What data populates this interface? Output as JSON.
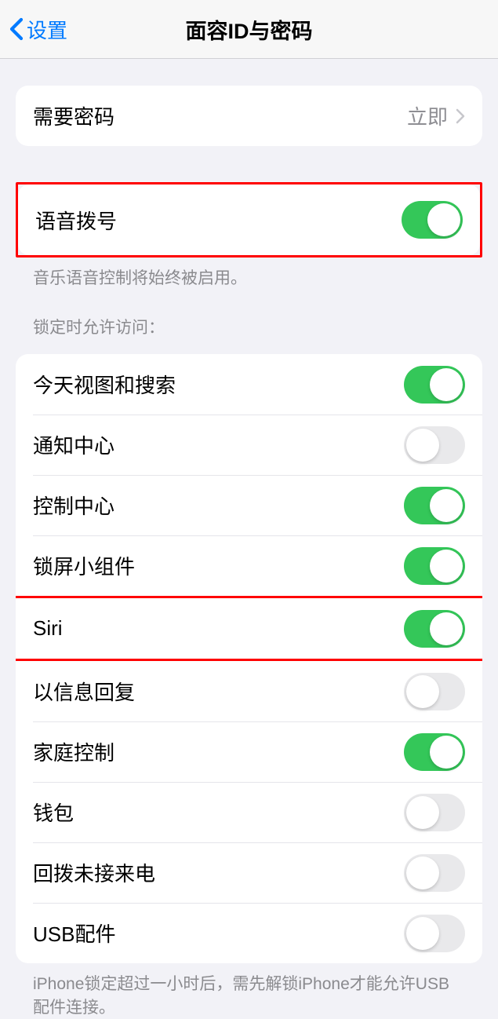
{
  "navbar": {
    "back_label": "设置",
    "title": "面容ID与密码"
  },
  "require_passcode": {
    "label": "需要密码",
    "value": "立即"
  },
  "voice_dial": {
    "label": "语音拨号",
    "on": true,
    "footer": "音乐语音控制将始终被启用。"
  },
  "lock_access": {
    "header": "锁定时允许访问：",
    "items": [
      {
        "label": "今天视图和搜索",
        "on": true
      },
      {
        "label": "通知中心",
        "on": false
      },
      {
        "label": "控制中心",
        "on": true
      },
      {
        "label": "锁屏小组件",
        "on": true
      },
      {
        "label": "Siri",
        "on": true,
        "highlight": true
      },
      {
        "label": "以信息回复",
        "on": false
      },
      {
        "label": "家庭控制",
        "on": true
      },
      {
        "label": "钱包",
        "on": false
      },
      {
        "label": "回拨未接来电",
        "on": false
      },
      {
        "label": "USB配件",
        "on": false
      }
    ],
    "footer": "iPhone锁定超过一小时后，需先解锁iPhone才能允许USB配件连接。"
  }
}
